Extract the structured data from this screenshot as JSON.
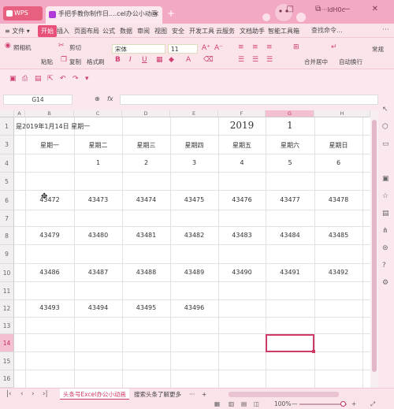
{
  "titlebar": {
    "app_label": "WPS",
    "doc_tab": "手把手教你制作日....cel办公小动画",
    "close": "×",
    "new_tab": "+",
    "account": "···ldH0c",
    "window_controls": "□ ⧉ — ✕"
  },
  "menu": {
    "hamburger": "≡ 文件 ▾",
    "items": [
      "开始",
      "插入",
      "页面布局",
      "公式",
      "数据",
      "审阅",
      "视图",
      "安全",
      "开发工具",
      "云服务",
      "文档助手",
      "智能工具箱"
    ],
    "search": "查找命令...",
    "right": "⋯"
  },
  "ribbon": {
    "screenshot": "照相机",
    "cut": "剪切",
    "paste": "粘贴",
    "copy": "复制",
    "format_painter": "格式刷",
    "font_name": "宋体",
    "font_size": "11",
    "merge": "合并居中",
    "autowrap": "自动换行",
    "general": "常规",
    "bold": "B",
    "italic": "I",
    "underline": "U",
    "font_larger": "A⁺",
    "font_smaller": "A⁻"
  },
  "formula": {
    "cell_ref": "G14",
    "fx": "fx",
    "zoom_icon": "⊕"
  },
  "grid": {
    "columns": [
      "A",
      "B",
      "C",
      "D",
      "E",
      "F",
      "G",
      "H"
    ],
    "rows": [
      "1",
      "3",
      "4",
      "5",
      "6",
      "7",
      "8",
      "9",
      "10",
      "11",
      "12",
      "13",
      "14",
      "15",
      "16"
    ],
    "b1_text": "是2019年1月14日  星期一",
    "f1_year": "2019",
    "g1_month": "1",
    "weekdays": [
      "星期一",
      "星期二",
      "星期三",
      "星期四",
      "星期五",
      "星期六",
      "星期日"
    ],
    "day_nums": [
      "1",
      "2",
      "3",
      "4",
      "5",
      "6"
    ],
    "row6": [
      "43472",
      "43473",
      "43474",
      "43475",
      "43476",
      "43477",
      "43478"
    ],
    "row8": [
      "43479",
      "43480",
      "43481",
      "43482",
      "43483",
      "43484",
      "43485"
    ],
    "row10": [
      "43486",
      "43487",
      "43488",
      "43489",
      "43490",
      "43491",
      "43492"
    ],
    "row12": [
      "43493",
      "43494",
      "43495",
      "43496"
    ]
  },
  "tabs": {
    "active": "头条号Excel办公小动画",
    "other": "搜索头条了解更多",
    "more": "···",
    "add": "+"
  },
  "status": {
    "zoom": "100%",
    "minus": "—",
    "plus": "+"
  }
}
